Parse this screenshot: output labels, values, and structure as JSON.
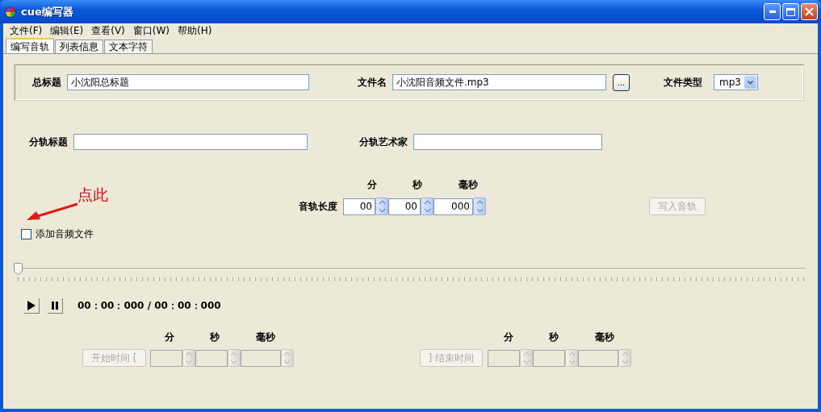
{
  "window": {
    "title": "cue编写器"
  },
  "menu": [
    {
      "label": "文件(F)"
    },
    {
      "label": "编辑(E)"
    },
    {
      "label": "查看(V)"
    },
    {
      "label": "窗口(W)"
    },
    {
      "label": "帮助(H)"
    }
  ],
  "tabs": [
    {
      "label": "编写音轨",
      "selected": true
    },
    {
      "label": "列表信息",
      "selected": false
    },
    {
      "label": "文本字符",
      "selected": false
    }
  ],
  "file_group": {
    "title_label": "总标题",
    "title_value": "小沈阳总标题",
    "filename_label": "文件名",
    "filename_value": "小沈阳音频文件.mp3",
    "browse_button": "...",
    "filetype_label": "文件类型",
    "filetype_value": "mp3"
  },
  "track_fields": {
    "title_label": "分轨标题",
    "artist_label": "分轨艺术家"
  },
  "track_length": {
    "label": "音轨长度",
    "units": [
      "分",
      "秒",
      "毫秒"
    ],
    "values": [
      "00",
      "00",
      "000"
    ],
    "write_button": {
      "label": "写入音轨",
      "disabled": true
    }
  },
  "annotation": {
    "text": "点此"
  },
  "add_audio": {
    "label": "添加音频文件",
    "checked": false
  },
  "seek_slider": {
    "level": 0
  },
  "playback": {
    "time": "00：00：000 / 00：00：000"
  },
  "start": {
    "button": {
      "label": "开始时间 [",
      "disabled": true
    },
    "units": [
      "分",
      "秒",
      "毫秒"
    ],
    "disabled": true
  },
  "end": {
    "button": {
      "label": "] 结束时间",
      "disabled": true
    },
    "units": [
      "分",
      "秒",
      "毫秒"
    ],
    "disabled": true
  }
}
